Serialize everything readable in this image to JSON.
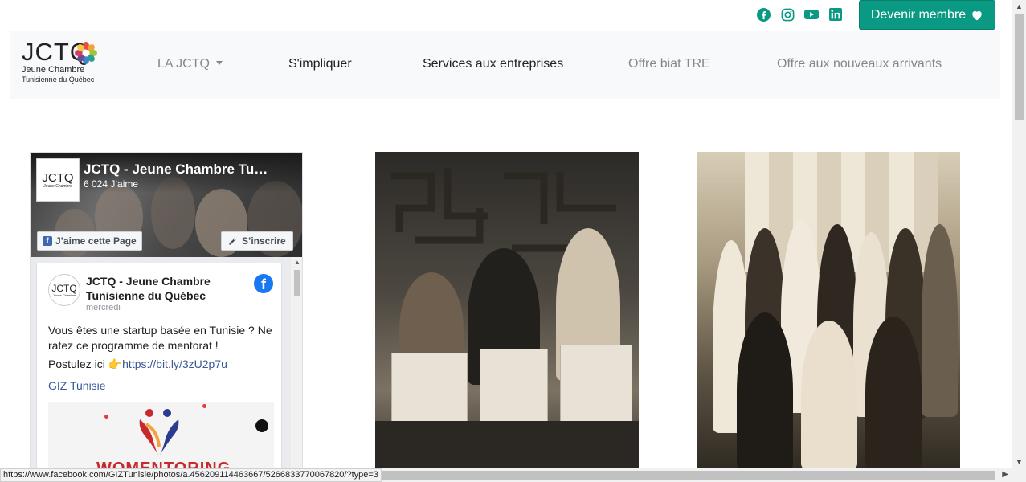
{
  "topbar": {
    "social": [
      "facebook-icon",
      "instagram-icon",
      "youtube-icon",
      "linkedin-icon"
    ],
    "member_button": "Devenir membre",
    "accent": "#0a9a84"
  },
  "logo": {
    "mark": "JCTQ",
    "line1": "Jeune Chambre",
    "line2": "Tunisienne du Québec"
  },
  "nav": {
    "items": [
      {
        "label": "LA JCTQ"
      },
      {
        "label": "S'impliquer"
      },
      {
        "label": "Services aux entreprises"
      },
      {
        "label": "Offre biat TRE"
      },
      {
        "label": "Offre aux nouveaux arrivants"
      }
    ]
  },
  "fb": {
    "page_title": "JCTQ - Jeune Chambre Tu…",
    "likes": "6 024 J’aime",
    "like_button": "J’aime cette Page",
    "subscribe_button": "S’inscrire",
    "post": {
      "author": "JCTQ - Jeune Chambre Tunisienne du Québec",
      "date": "mercredi",
      "text": "Vous êtes une startup basée en Tunisie ? Ne ratez ce programme de mentorat !",
      "link_prefix": "Postulez ici 👉",
      "link": "https://bit.ly/3zU2p7u",
      "tag": "GIZ Tunisie",
      "image_word": "WOMENTORING"
    }
  },
  "status_url": "https://www.facebook.com/GIZTunisie/photos/a.456209114463667/5266833770067820/?type=3"
}
